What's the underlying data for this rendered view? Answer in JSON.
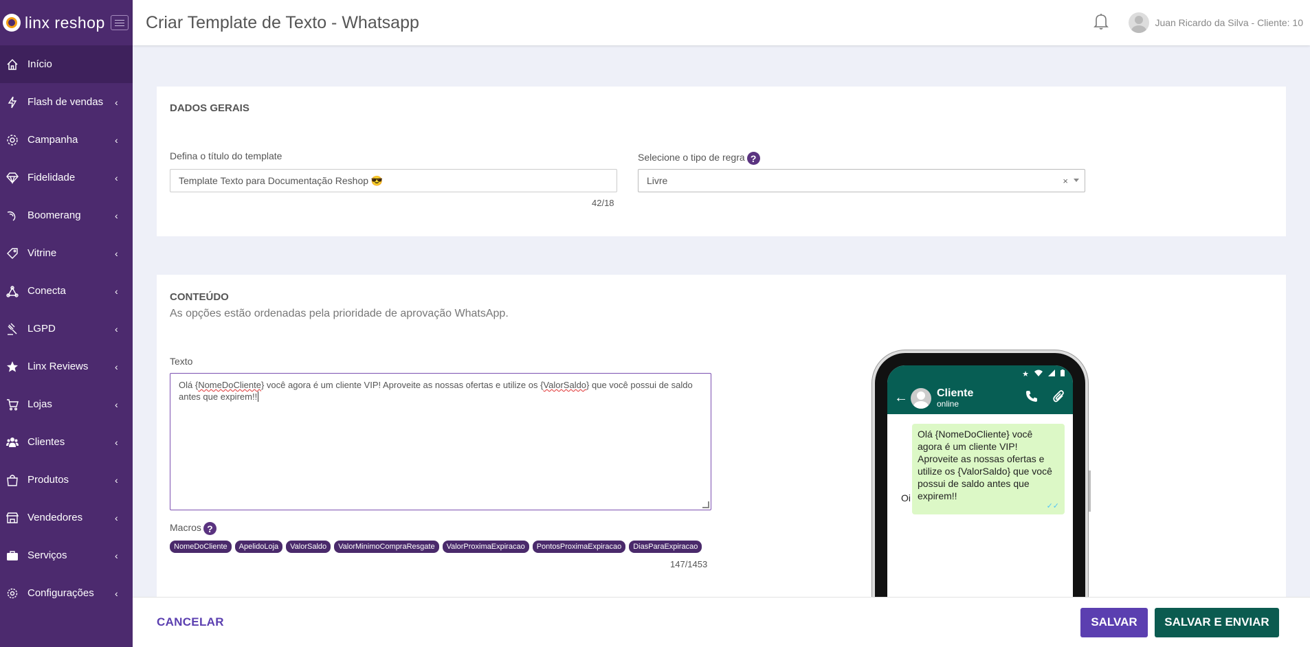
{
  "brand": {
    "name_light": "linx",
    "name_bold": "reshop"
  },
  "sidebar": {
    "items": [
      {
        "label": "Início",
        "icon": "home-icon",
        "active": true,
        "has_chevron": false
      },
      {
        "label": "Flash de vendas",
        "icon": "lightning-icon",
        "has_chevron": true
      },
      {
        "label": "Campanha",
        "icon": "gear-icon",
        "has_chevron": true
      },
      {
        "label": "Fidelidade",
        "icon": "diamond-icon",
        "has_chevron": true
      },
      {
        "label": "Boomerang",
        "icon": "boomerang-icon",
        "has_chevron": true
      },
      {
        "label": "Vitrine",
        "icon": "tag-icon",
        "has_chevron": true
      },
      {
        "label": "Conecta",
        "icon": "connect-icon",
        "has_chevron": true
      },
      {
        "label": "LGPD",
        "icon": "gavel-icon",
        "has_chevron": true
      },
      {
        "label": "Linx Reviews",
        "icon": "star-icon",
        "has_chevron": true
      },
      {
        "label": "Lojas",
        "icon": "cart-icon",
        "has_chevron": true
      },
      {
        "label": "Clientes",
        "icon": "users-icon",
        "has_chevron": true
      },
      {
        "label": "Produtos",
        "icon": "bag-icon",
        "has_chevron": true
      },
      {
        "label": "Vendedores",
        "icon": "store-icon",
        "has_chevron": true
      },
      {
        "label": "Serviços",
        "icon": "briefcase-icon",
        "has_chevron": true
      },
      {
        "label": "Configurações",
        "icon": "settings-icon",
        "has_chevron": true
      }
    ]
  },
  "header": {
    "title": "Criar Template de Texto - Whatsapp",
    "user": "Juan Ricardo da Silva - Cliente: 10"
  },
  "general": {
    "section_title": "DADOS GERAIS",
    "template_title_label": "Defina o título do template",
    "template_title_value": "Template Texto para Documentação Reshop 😎",
    "template_title_counter": "42/18",
    "rule_type_label": "Selecione o tipo de regra",
    "rule_type_value": "Livre",
    "clear_symbol": "×"
  },
  "content": {
    "section_title": "CONTEÚDO",
    "subtitle": "As opções estão ordenadas pela prioridade de aprovação WhatsApp.",
    "text_label": "Texto",
    "text_part1": "Olá {",
    "text_macro1": "NomeDoCliente",
    "text_part2": "} você agora é um cliente VIP! Aproveite as nossas ofertas e utilize os {",
    "text_macro2": "ValorSaldo",
    "text_part3": "} que você possui de saldo antes que expirem!!",
    "macros_label": "Macros",
    "macros": [
      "NomeDoCliente",
      "ApelidoLoja",
      "ValorSaldo",
      "ValorMinimoCompraResgate",
      "ValorProximaExpiracao",
      "PontosProximaExpiracao",
      "DiasParaExpiracao"
    ],
    "text_counter": "147/1453"
  },
  "preview": {
    "contact_name": "Cliente",
    "contact_status": "online",
    "message": "Olá {NomeDoCliente} você agora é um cliente VIP! Aproveite as nossas ofertas e utilize os {ValorSaldo} que você possui de saldo antes que expirem!!",
    "reply": "Oi",
    "ticks": "✓✓"
  },
  "footer": {
    "cancel_label": "CANCELAR",
    "save_label": "SALVAR",
    "save_send_label": "SALVAR E ENVIAR"
  },
  "colors": {
    "sidebar_bg": "#4c2a6e",
    "accent_purple": "#5b3fb0",
    "whatsapp_green": "#075e54",
    "bubble_green": "#dcf8c6",
    "save_send_green": "#0b5b50"
  }
}
